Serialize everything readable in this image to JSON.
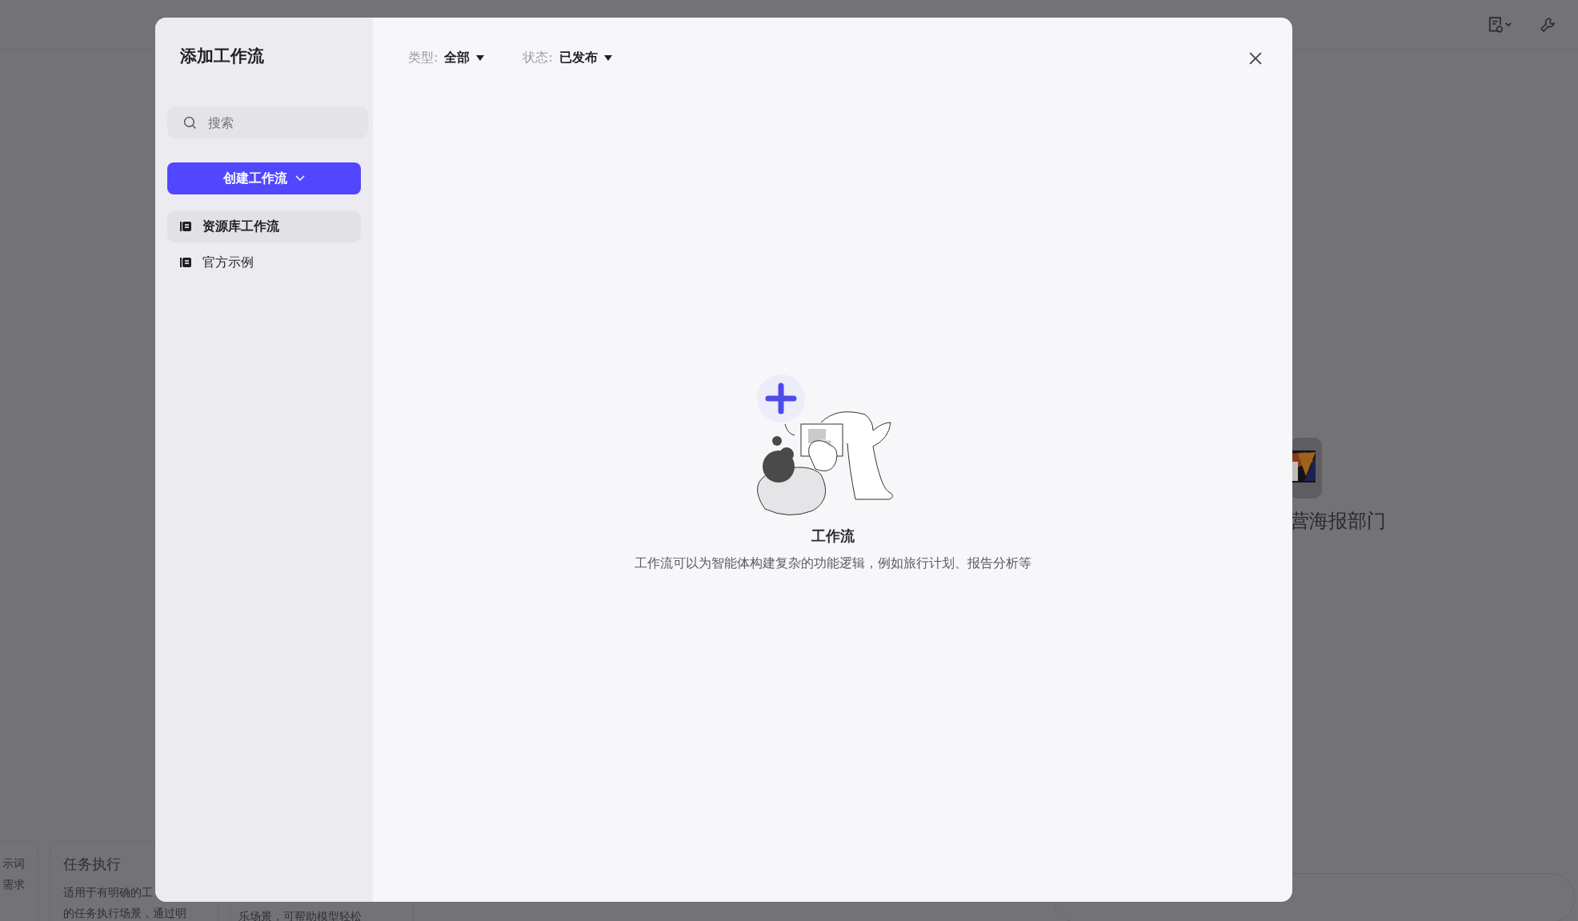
{
  "background": {
    "agent_tile": {
      "name": "营海报部门"
    },
    "template_cards": [
      {
        "lines": [
          "示词",
          "需求"
        ]
      },
      {
        "title": "任务执行",
        "lines": [
          "适用于有明确的工",
          "的任务执行场景，通过明"
        ]
      },
      {
        "lines": [
          "乐场景，可帮助模型轻松"
        ]
      }
    ]
  },
  "modal": {
    "title": "添加工作流",
    "search": {
      "placeholder": "搜索"
    },
    "create_button": {
      "label": "创建工作流"
    },
    "nav_items": [
      {
        "label": "资源库工作流",
        "selected": true
      },
      {
        "label": "官方示例",
        "selected": false
      }
    ],
    "filters": [
      {
        "label": "类型:",
        "value": "全部"
      },
      {
        "label": "状态:",
        "value": "已发布"
      }
    ],
    "empty_state": {
      "title": "工作流",
      "description": "工作流可以为智能体构建复杂的功能逻辑，例如旅行计划、报告分析等"
    }
  }
}
